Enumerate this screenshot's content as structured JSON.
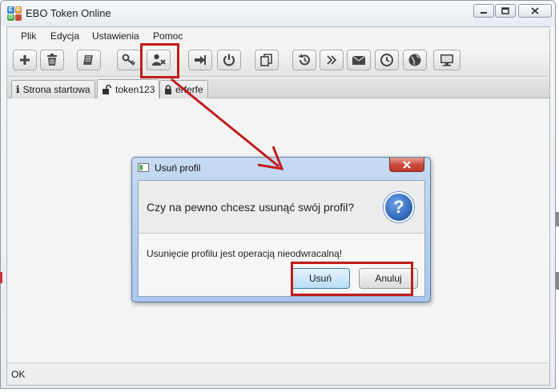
{
  "window": {
    "title": "EBO Token Online",
    "app_icon_letters": [
      "E",
      "B",
      "O",
      ""
    ],
    "controls": [
      "minimize-icon",
      "maximize-icon",
      "close-icon"
    ]
  },
  "menu": {
    "items": [
      "Plik",
      "Edycja",
      "Ustawienia",
      "Pomoc"
    ]
  },
  "toolbar": {
    "buttons": [
      {
        "icon": "plus-icon"
      },
      {
        "icon": "trash-icon"
      },
      {
        "icon": "book-icon"
      },
      {
        "icon": "key-icon"
      },
      {
        "icon": "remove-user-icon",
        "highlighted": true
      },
      {
        "icon": "logout-icon"
      },
      {
        "icon": "power-icon"
      },
      {
        "icon": "copy-icon"
      },
      {
        "icon": "history-icon"
      },
      {
        "icon": "fast-forward-icon"
      },
      {
        "icon": "mail-icon"
      },
      {
        "icon": "clock-icon"
      },
      {
        "icon": "globe-icon"
      },
      {
        "icon": "monitor-icon"
      }
    ]
  },
  "tabs": [
    {
      "label": "Strona startowa",
      "icon": "info-icon"
    },
    {
      "label": "token123",
      "icon": "unlock-icon",
      "active": true
    },
    {
      "label": "erferfe",
      "icon": "lock-icon"
    }
  ],
  "dialog": {
    "title": "Usuń profil",
    "question": "Czy na pewno chcesz usunąć swój profil?",
    "detail": "Usunięcie profilu jest operacją nieodwracalną!",
    "ok_label": "Usuń",
    "cancel_label": "Anuluj",
    "icon": "question-icon"
  },
  "status": {
    "text": "OK"
  },
  "colors": {
    "annotation": "#c11c1c",
    "dialog_frame": "#a9c6ea",
    "question_icon": "#2c63b8"
  }
}
